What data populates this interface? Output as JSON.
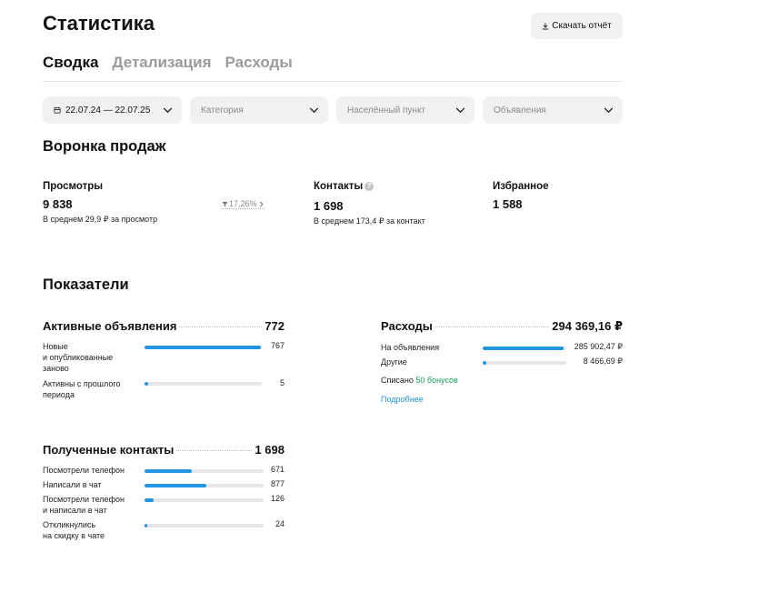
{
  "title": "Статистика",
  "download_label": "Скачать отчёт",
  "tabs": [
    {
      "label": "Сводка",
      "active": true
    },
    {
      "label": "Детализация",
      "active": false
    },
    {
      "label": "Расходы",
      "active": false
    }
  ],
  "filters": {
    "date": "22.07.24 — 22.07.25",
    "category": "Категория",
    "city": "Населённый пункт",
    "ads": "Объявления"
  },
  "funnel": {
    "title": "Воронка продаж",
    "views": {
      "label": "Просмотры",
      "value": "9 838",
      "sub": "В среднем 29,9 ₽ за просмотр",
      "conversion": "17,26%"
    },
    "contacts": {
      "label": "Контакты",
      "value": "1 698",
      "sub": "В среднем 173,4 ₽ за контакт"
    },
    "favorites": {
      "label": "Избранное",
      "value": "1 588"
    }
  },
  "indicators": {
    "title": "Показатели",
    "active_ads": {
      "title": "Активные объявления",
      "total": "772",
      "rows": [
        {
          "label": "Новые\nи опубликованные\nзаново",
          "value": "767",
          "pct": 99.4
        },
        {
          "label": "Активны с прошлого\nпериода",
          "value": "5",
          "pct": 3
        }
      ]
    },
    "expenses": {
      "title": "Расходы",
      "total": "294 369,16 ₽",
      "rows": [
        {
          "label": "На объявления",
          "value": "285 902,47 ₽",
          "pct": 97.1
        },
        {
          "label": "Другие",
          "value": "8 466,69 ₽",
          "pct": 4
        }
      ],
      "bonus_prefix": "Списано",
      "bonus_text": "50 бонусов",
      "more_link": "Подробнее"
    },
    "contacts": {
      "title": "Полученные контакты",
      "total": "1 698",
      "rows": [
        {
          "label": "Посмотрели телефон",
          "value": "671",
          "pct": 39.5
        },
        {
          "label": "Написали в чат",
          "value": "877",
          "pct": 51.6
        },
        {
          "label": "Посмотрели телефон\nи написали в чат",
          "value": "126",
          "pct": 7.4
        },
        {
          "label": "Откликнулись\nна скидку в чате",
          "value": "24",
          "pct": 2
        }
      ]
    }
  },
  "colors": {
    "accent": "#1f94e0",
    "track": "#e6e6e6",
    "green": "#1aa05a",
    "link": "#1f94e0",
    "filter_bg": "#f2f1f0"
  }
}
